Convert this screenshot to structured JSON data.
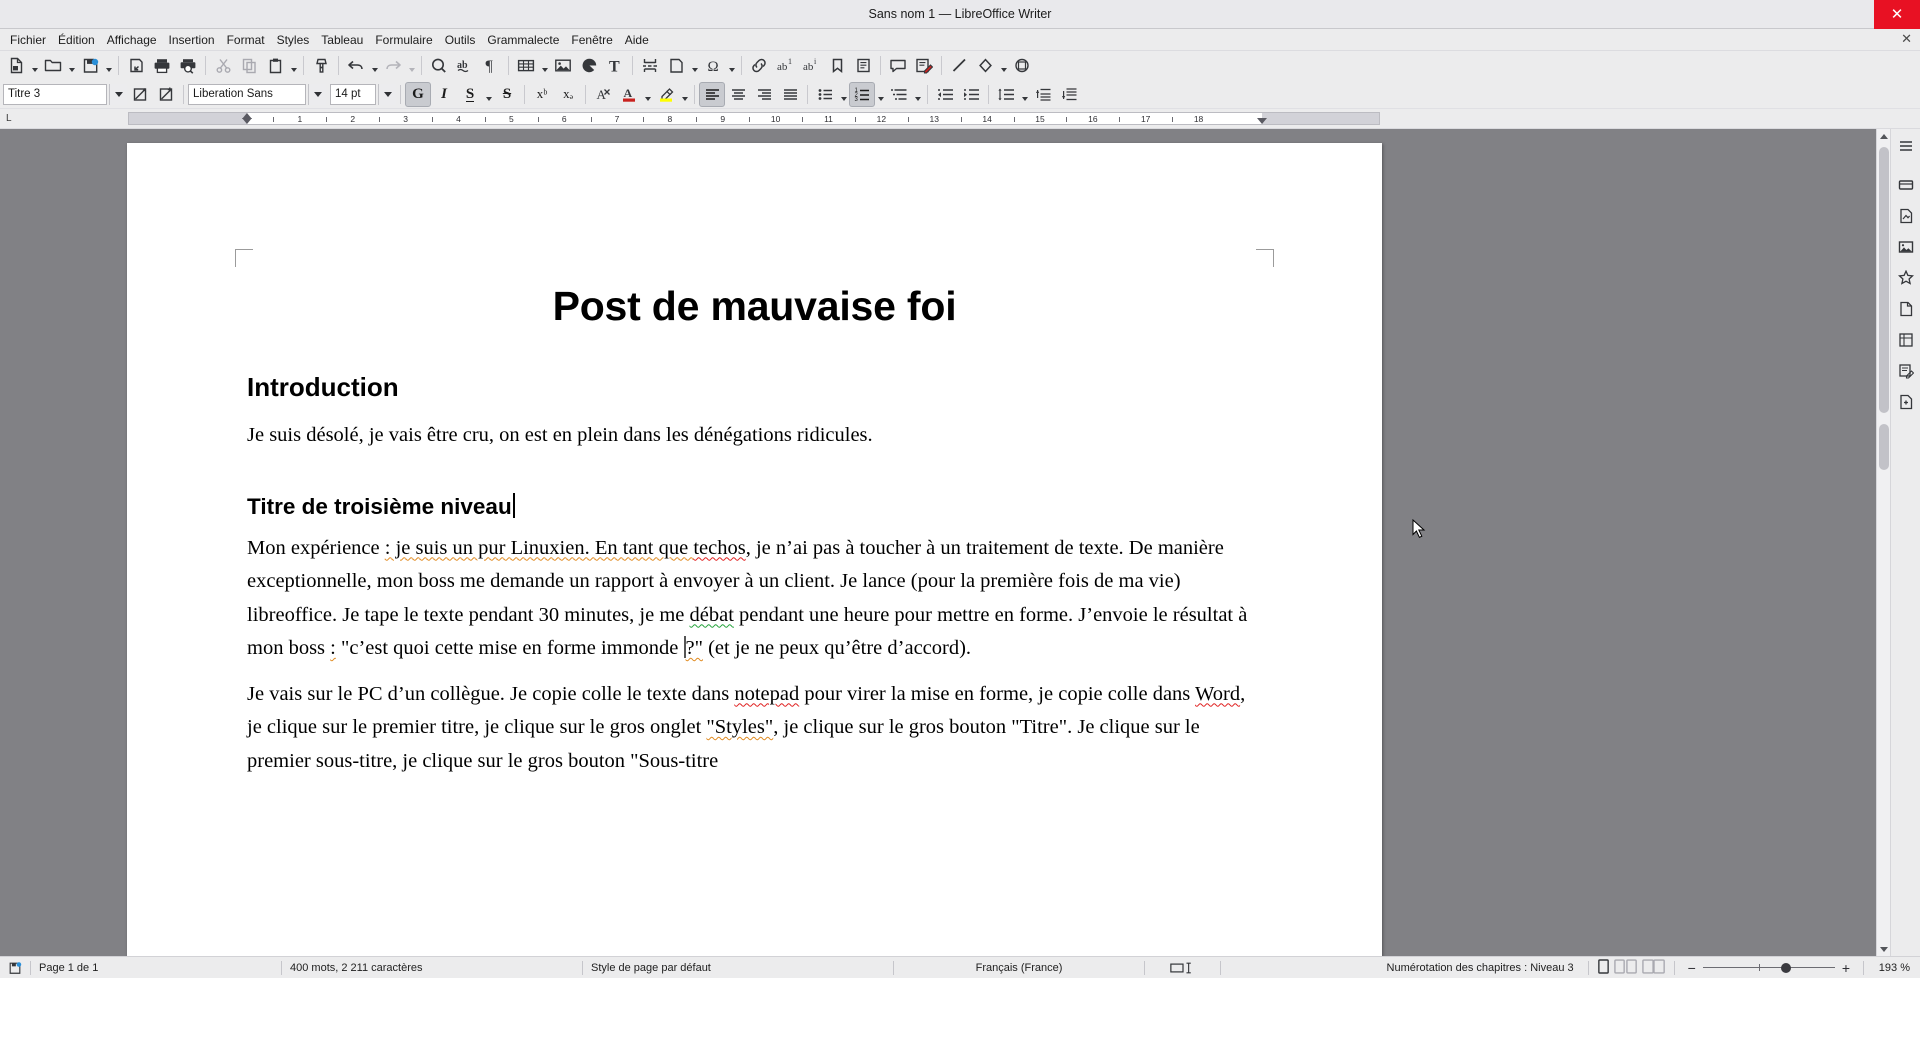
{
  "window": {
    "title": "Sans nom 1 — LibreOffice Writer",
    "close_glyph": "✕",
    "doc_close_glyph": "✕"
  },
  "menubar": {
    "items": [
      {
        "label": "Fichier"
      },
      {
        "label": "Édition"
      },
      {
        "label": "Affichage"
      },
      {
        "label": "Insertion"
      },
      {
        "label": "Format"
      },
      {
        "label": "Styles"
      },
      {
        "label": "Tableau"
      },
      {
        "label": "Formulaire"
      },
      {
        "label": "Outils"
      },
      {
        "label": "Grammalecte"
      },
      {
        "label": "Fenêtre"
      },
      {
        "label": "Aide"
      }
    ]
  },
  "standard_toolbar": {
    "buttons": [
      {
        "name": "new-document",
        "tooltip": "Nouveau"
      },
      {
        "name": "open-document",
        "tooltip": "Ouvrir"
      },
      {
        "name": "save-document",
        "tooltip": "Enregistrer"
      },
      {
        "name": "export-pdf",
        "tooltip": "Exporter au format PDF"
      },
      {
        "name": "print",
        "tooltip": "Imprimer"
      },
      {
        "name": "print-preview",
        "tooltip": "Aperçu"
      },
      {
        "name": "cut",
        "tooltip": "Couper"
      },
      {
        "name": "copy",
        "tooltip": "Copier"
      },
      {
        "name": "paste",
        "tooltip": "Coller"
      },
      {
        "name": "clone-formatting",
        "tooltip": "Cloner le formatage"
      },
      {
        "name": "undo",
        "tooltip": "Annuler"
      },
      {
        "name": "redo",
        "tooltip": "Rétablir"
      },
      {
        "name": "find-replace",
        "tooltip": "Rechercher & remplacer"
      },
      {
        "name": "spelling",
        "tooltip": "Orthographe"
      },
      {
        "name": "formatting-marks",
        "tooltip": "Marques de formatage"
      },
      {
        "name": "insert-table",
        "tooltip": "Insérer un tableau"
      },
      {
        "name": "insert-image",
        "tooltip": "Insérer une image"
      },
      {
        "name": "insert-chart",
        "tooltip": "Insérer un diagramme"
      },
      {
        "name": "insert-textbox",
        "tooltip": "Zone de texte"
      },
      {
        "name": "page-break",
        "tooltip": "Saut de page"
      },
      {
        "name": "insert-field",
        "tooltip": "Insérer un champ"
      },
      {
        "name": "special-character",
        "tooltip": "Caractère spécial"
      },
      {
        "name": "insert-hyperlink",
        "tooltip": "Insérer un hyperlien"
      },
      {
        "name": "insert-footnote",
        "tooltip": "Note de bas de page"
      },
      {
        "name": "insert-endnote",
        "tooltip": "Note de fin"
      },
      {
        "name": "insert-bookmark",
        "tooltip": "Insérer un signet"
      },
      {
        "name": "insert-cross-reference",
        "tooltip": "Renvoi"
      },
      {
        "name": "insert-comment",
        "tooltip": "Insérer un commentaire"
      },
      {
        "name": "track-changes",
        "tooltip": "Suivi des modifications"
      },
      {
        "name": "insert-line",
        "tooltip": "Insérer une ligne"
      },
      {
        "name": "basic-shapes",
        "tooltip": "Formes de base"
      },
      {
        "name": "show-draw-functions",
        "tooltip": "Fonctions de dessin"
      }
    ]
  },
  "formatting_toolbar": {
    "paragraph_style": {
      "value": "Titre 3",
      "placeholder": "Style de paragraphe"
    },
    "update_style_tooltip": "Actualiser le style",
    "new_style_tooltip": "Nouveau style",
    "font_name": {
      "value": "Liberation Sans",
      "placeholder": "Nom de police"
    },
    "font_size": {
      "value": "14 pt",
      "placeholder": "Taille"
    },
    "buttons": [
      {
        "name": "bold",
        "label": "G",
        "active": true
      },
      {
        "name": "italic",
        "label": "I",
        "active": false
      },
      {
        "name": "underline",
        "label": "S",
        "active": false
      },
      {
        "name": "strikethrough",
        "label": "S",
        "active": false
      },
      {
        "name": "superscript",
        "label": "xᵇ",
        "active": false
      },
      {
        "name": "subscript",
        "label": "xₔ",
        "active": false
      },
      {
        "name": "clear-formatting",
        "active": false
      },
      {
        "name": "font-color",
        "active": false
      },
      {
        "name": "highlight-color",
        "active": false
      },
      {
        "name": "align-left",
        "active": true
      },
      {
        "name": "align-center",
        "active": false
      },
      {
        "name": "align-right",
        "active": false
      },
      {
        "name": "align-justified",
        "active": false
      },
      {
        "name": "unordered-list",
        "active": false
      },
      {
        "name": "ordered-list",
        "active": true
      },
      {
        "name": "outline-list",
        "active": false
      },
      {
        "name": "decrease-indent",
        "active": false
      },
      {
        "name": "increase-indent",
        "active": false
      },
      {
        "name": "line-spacing",
        "active": false
      },
      {
        "name": "paragraph-spacing-above",
        "active": false
      },
      {
        "name": "paragraph-spacing-below",
        "active": false
      }
    ]
  },
  "ruler": {
    "corner_label": "L",
    "numbers": [
      "1",
      "2",
      "3",
      "4",
      "5",
      "6",
      "7",
      "8",
      "9",
      "10",
      "11",
      "12",
      "13",
      "14",
      "15",
      "16",
      "17",
      "18"
    ]
  },
  "document": {
    "title": "Post de mauvaise foi",
    "heading_intro": "Introduction",
    "para_intro": "Je suis désolé, je vais être cru, on est en plein dans les dénégations ridicules.",
    "heading_level3": "Titre de troisième niveau",
    "para2": {
      "s1": "Mon expérience ",
      "s2": ": je suis un pur Linuxien. En tant que ",
      "s3": "techos",
      "s4": ", je n’ai pas à toucher à un traitement de texte. De manière exceptionnelle, mon boss me demande un rapport à envoyer à un client. Je lance (pour la première fois de ma vie) libreoffice. Je tape le texte pendant 30 minutes, je me ",
      "s5": "débat",
      "s6": " pendant une heure pour mettre en forme. J’envoie le résultat à mon boss ",
      "s7": ":",
      "s8": " \"c’est quoi cette mise en forme immonde ",
      "s9": "?\"",
      "s10": " (et je ne peux qu’être d’accord)."
    },
    "para3": {
      "s1": "Je vais sur le PC d’un collègue. Je copie colle le texte dans ",
      "s2": "notepad",
      "s3": " pour virer la mise en forme, je copie colle dans ",
      "s4": "Word",
      "s5": ", je clique sur le premier titre, je clique sur le gros onglet ",
      "s6": "\"Styles\"",
      "s7": ", je clique sur le gros bouton \"Titre\". Je clique sur le premier sous-titre, je clique sur le gros bouton \"Sous-titre"
    }
  },
  "sidebar": {
    "items": [
      {
        "name": "sidebar-settings",
        "label": "Paramètres de la barre latérale"
      },
      {
        "name": "sidebar-properties",
        "label": "Propriétés"
      },
      {
        "name": "sidebar-page",
        "label": "Page"
      },
      {
        "name": "sidebar-gallery",
        "label": "Galerie"
      },
      {
        "name": "sidebar-styles",
        "label": "Styles"
      },
      {
        "name": "sidebar-navigator",
        "label": "Navigateur"
      },
      {
        "name": "sidebar-page-deck",
        "label": "Page"
      },
      {
        "name": "sidebar-manage-changes",
        "label": "Gérer les modifications"
      },
      {
        "name": "sidebar-design",
        "label": "Design"
      }
    ]
  },
  "statusbar": {
    "page_info": "Page 1 de 1",
    "word_count": "400 mots, 2 211 caractères",
    "page_style": "Style de page par défaut",
    "language": "Français (France)",
    "selection_mode_icon": "selection-mode-icon",
    "chapter_numbering": "Numérotation des chapitres : Niveau 3",
    "view_layouts": [
      {
        "name": "single-page-view",
        "active": true
      },
      {
        "name": "multi-page-view",
        "active": false
      },
      {
        "name": "book-view",
        "active": false
      }
    ],
    "zoom_out": "−",
    "zoom_in": "+",
    "zoom_level": "193 %"
  },
  "colors": {
    "titlebar_bg": "#e9e9ec",
    "toolbar_bg": "#ececed",
    "close_red": "#e81123",
    "canvas_bg": "#818185",
    "page_bg": "#ffffff",
    "accent_blue": "#2a8fd8",
    "spell_red": "#e02020",
    "grammar_green": "#23a23a",
    "grammar_orange": "#e08a20",
    "font_color_red": "#c9211e",
    "highlight_yellow": "#ffff00"
  }
}
